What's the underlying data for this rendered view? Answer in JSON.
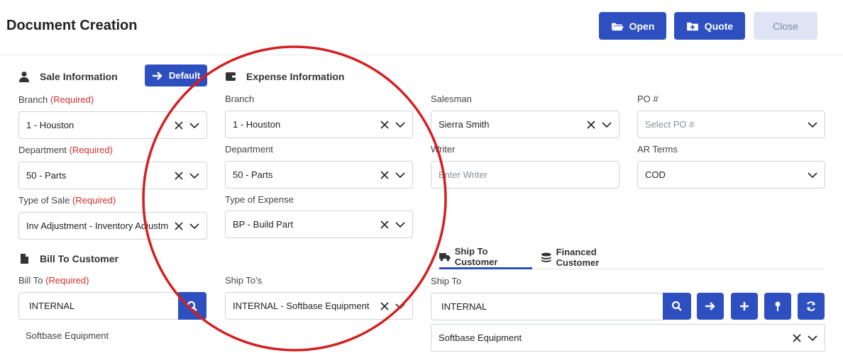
{
  "header": {
    "title": "Document Creation",
    "open_label": "Open",
    "quote_label": "Quote",
    "close_label": "Close"
  },
  "sale_info": {
    "title": "Sale Information",
    "default_label": "Default",
    "branch_label": "Branch",
    "department_label": "Department",
    "type_label": "Type of Sale",
    "required_text": "(Required)",
    "branch_value": "1 - Houston",
    "department_value": "50 - Parts",
    "type_value": "Inv Adjustment - Inventory Adjustm"
  },
  "expense_info": {
    "title": "Expense Information",
    "branch_label": "Branch",
    "department_label": "Department",
    "type_label": "Type of Expense",
    "branch_value": "1 - Houston",
    "department_value": "50 - Parts",
    "type_value": "BP - Build Part"
  },
  "other_info": {
    "salesman_label": "Salesman",
    "salesman_value": "Sierra Smith",
    "po_label": "PO #",
    "po_placeholder": "Select PO #",
    "writer_label": "Writer",
    "writer_placeholder": "Enter Writer",
    "ar_terms_label": "AR Terms",
    "ar_terms_value": "COD"
  },
  "bill_to": {
    "title": "Bill To Customer",
    "label": "Bill To",
    "value": "INTERNAL",
    "customer_name": "Softbase Equipment"
  },
  "ship_tos": {
    "label": "Ship To's",
    "value": "INTERNAL - Softbase Equipment"
  },
  "ship_to": {
    "tabs": [
      "Ship To Customer",
      "Financed Customer"
    ],
    "active_tab": 0,
    "label": "Ship To",
    "value": "INTERNAL",
    "customer_value": "Softbase Equipment"
  },
  "colors": {
    "primary": "#2e4fbf",
    "required": "#d32f2f",
    "annotation": "#d42020"
  }
}
